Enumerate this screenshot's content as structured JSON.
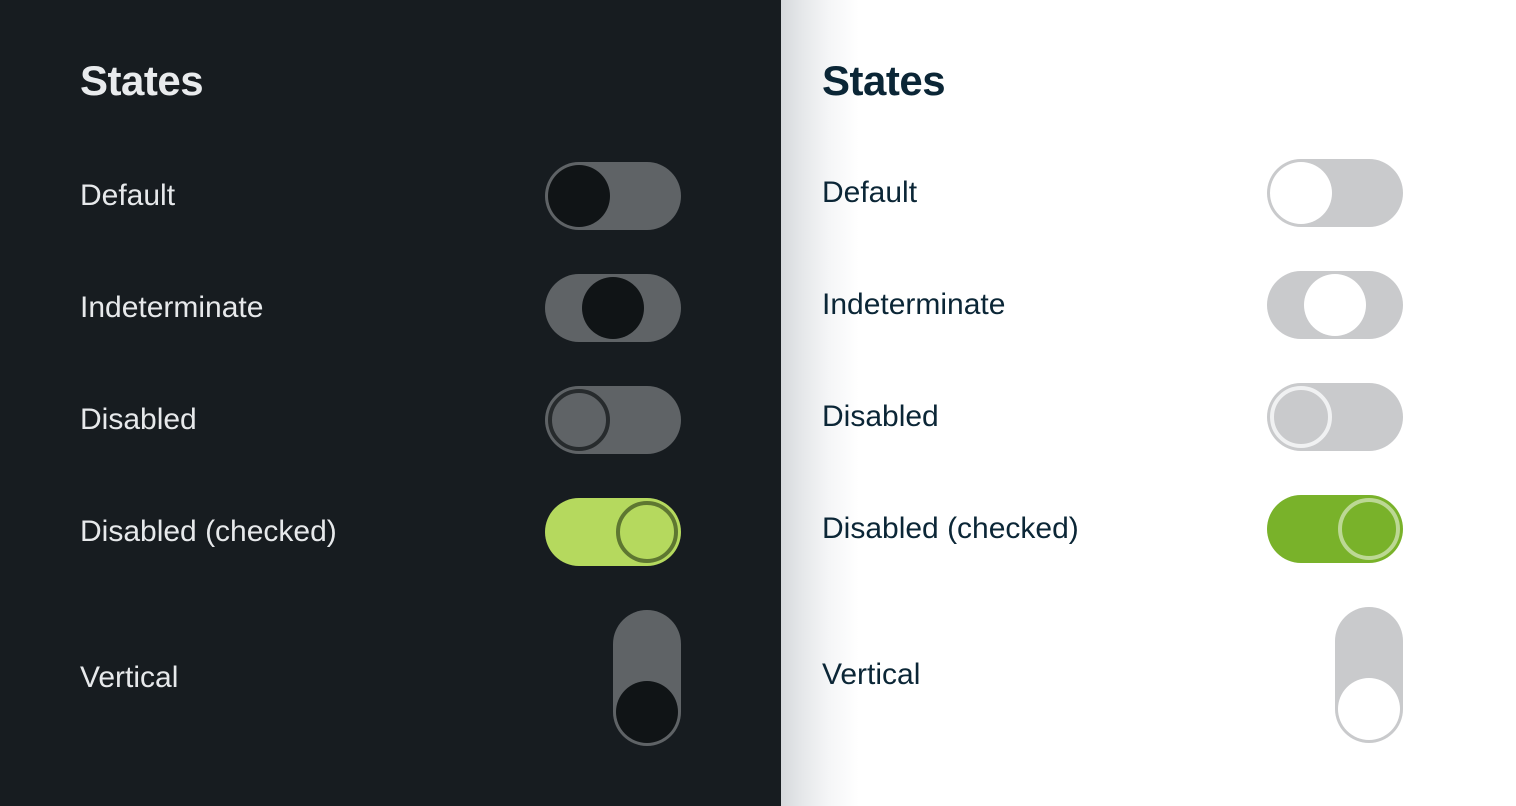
{
  "panels": [
    {
      "theme": "dark",
      "heading": "States",
      "background": "#171c20",
      "text_color": "#e7e9eb",
      "rows": [
        {
          "label": "Default",
          "state": "default",
          "thumb_position": "left",
          "orientation": "horizontal"
        },
        {
          "label": "Indeterminate",
          "state": "indeterminate",
          "thumb_position": "center",
          "orientation": "horizontal"
        },
        {
          "label": "Disabled",
          "state": "disabled",
          "thumb_position": "left",
          "orientation": "horizontal"
        },
        {
          "label": "Disabled (checked)",
          "state": "disabled-checked",
          "thumb_position": "right",
          "orientation": "horizontal"
        },
        {
          "label": "Vertical",
          "state": "default",
          "thumb_position": "bottom",
          "orientation": "vertical"
        }
      ],
      "track_color": "#5f6366",
      "thumb_color": "#101416",
      "checked_color": "#b5d95e",
      "checked_ring_color": "#5e7731",
      "disabled_ring_color": "#272b2d"
    },
    {
      "theme": "light",
      "heading": "States",
      "background": "#ffffff",
      "text_color": "#0b2636",
      "rows": [
        {
          "label": "Default",
          "state": "default",
          "thumb_position": "left",
          "orientation": "horizontal"
        },
        {
          "label": "Indeterminate",
          "state": "indeterminate",
          "thumb_position": "center",
          "orientation": "horizontal"
        },
        {
          "label": "Disabled",
          "state": "disabled",
          "thumb_position": "left",
          "orientation": "horizontal"
        },
        {
          "label": "Disabled (checked)",
          "state": "disabled-checked",
          "thumb_position": "right",
          "orientation": "horizontal"
        },
        {
          "label": "Vertical",
          "state": "default",
          "thumb_position": "bottom",
          "orientation": "vertical"
        }
      ],
      "track_color": "#c9cacc",
      "thumb_color": "#ffffff",
      "checked_color": "#79b22a",
      "checked_ring_color": "#bcd894",
      "disabled_ring_color": "#f0f1f2"
    }
  ]
}
